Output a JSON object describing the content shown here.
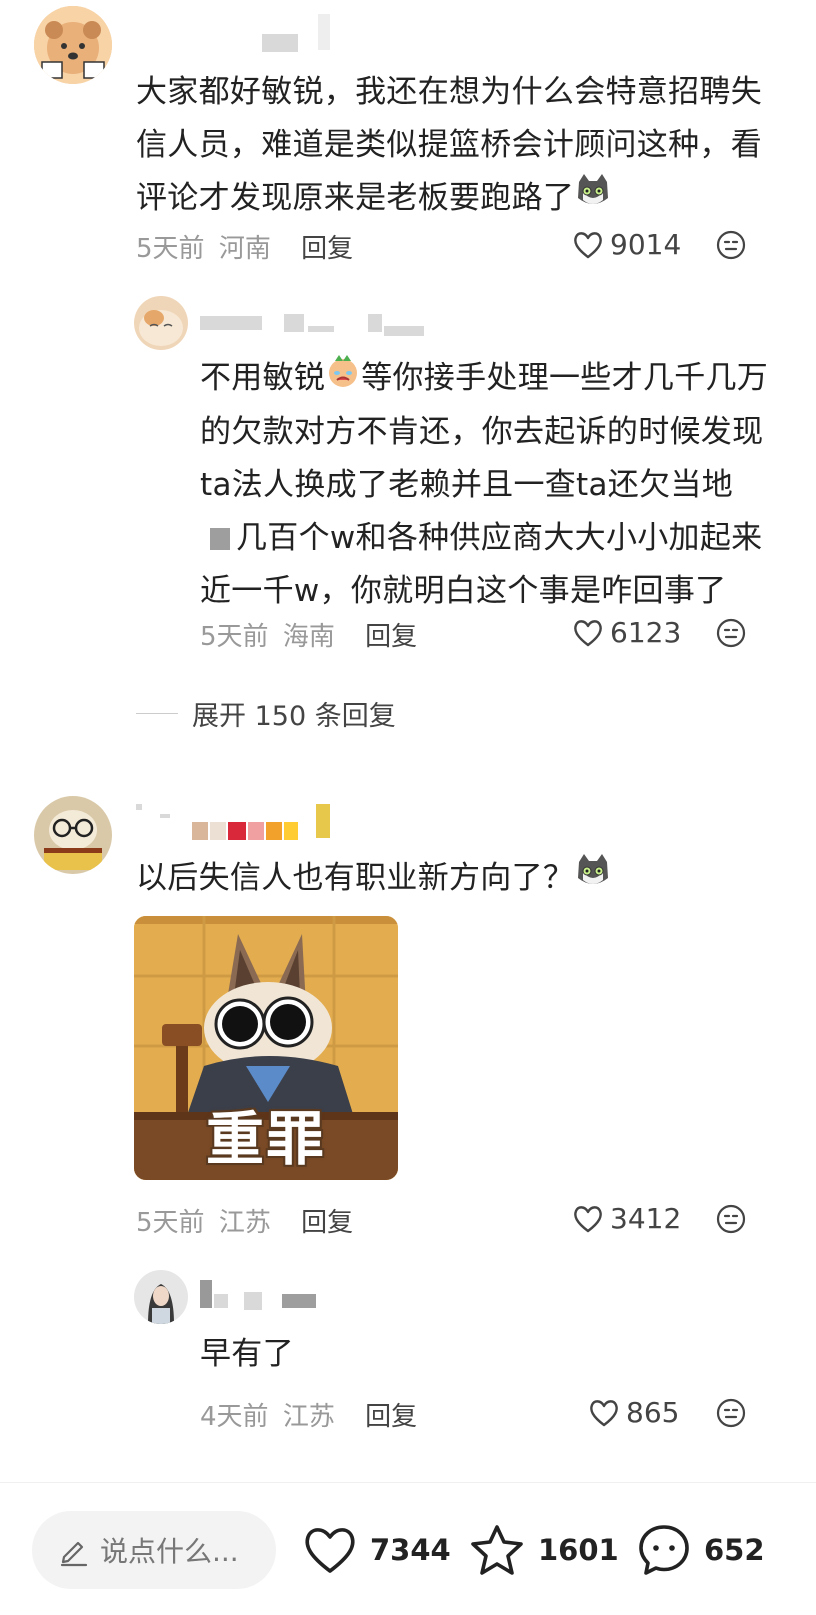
{
  "comments": [
    {
      "text": "大家都好敏锐，我还在想为什么会特意招聘失信人员，难道是类似提篮桥会计顾问这种，看评论才发现原来是老板要跑路了",
      "lines": [
        "大家都好敏锐，我还在想为什么会特意招聘失",
        "信人员，难道是类似提篮桥会计顾问这种，看",
        "评论才发现原来是老板要跑路了"
      ],
      "emoji": "cat-emoji",
      "time": "5天前",
      "location": "河南",
      "reply_label": "回复",
      "likes": "9014"
    },
    {
      "lines": [
        "不用敏锐",
        "等你接手处理一些才几千几万",
        "的欠款对方不肯还，你去起诉的时候发现",
        "ta法人换成了老赖并且一查ta还欠当地",
        "几百个w和各种供应商大大小小加起来",
        "近一千w，你就明白这个事是咋回事了"
      ],
      "emoji": "crying-face-emoji",
      "time": "5天前",
      "location": "海南",
      "reply_label": "回复",
      "likes": "6123"
    },
    {
      "expand_label": "展开 150 条回复"
    },
    {
      "text": "以后失信人也有职业新方向了？",
      "emoji": "cat-emoji",
      "image_caption": "重罪",
      "time": "5天前",
      "location": "江苏",
      "reply_label": "回复",
      "likes": "3412"
    },
    {
      "text": "早有了",
      "time": "4天前",
      "location": "江苏",
      "reply_label": "回复",
      "likes": "865"
    }
  ],
  "bottom_bar": {
    "input_placeholder": "说点什么...",
    "likes": "7344",
    "favorites": "1601",
    "comments": "652"
  },
  "colors": {
    "meta_gray": "#999999",
    "text": "#222222",
    "pill_bg": "#f3f3f3"
  }
}
